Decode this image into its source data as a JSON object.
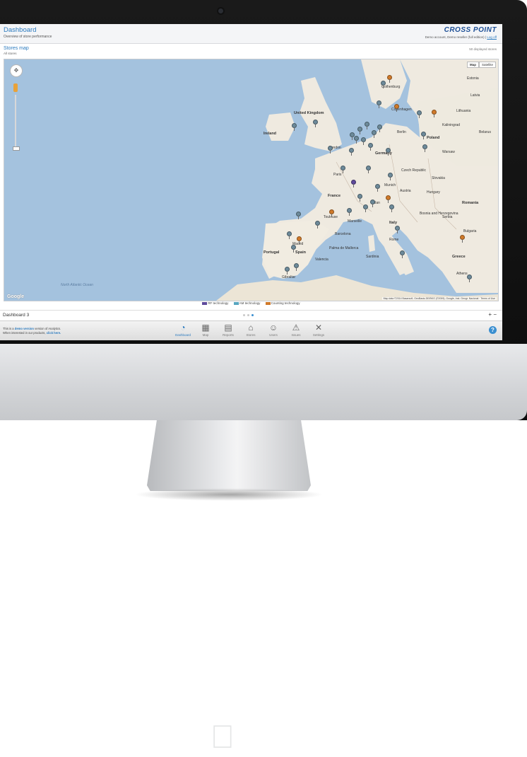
{
  "header": {
    "title": "Dashboard",
    "subtitle": "Overview of store performance",
    "brand": "CROSS POINT",
    "account": "Demo account, Demo reseller (full edition) |",
    "logout": "Log off"
  },
  "section": {
    "title": "Stores map",
    "subtitle": "All stores",
    "count_text": "50 displayed stores"
  },
  "map": {
    "types": [
      "Map",
      "Satellite"
    ],
    "active_type": "Map",
    "logo": "Google",
    "attribution": "Map data ©2014 Basarsoft, GeoBasis-DE/BKG (©2009), Google, Inst. Geogr. Nacional · Terms of Use",
    "labels": {
      "uk": "United Kingdom",
      "ireland": "Ireland",
      "france": "France",
      "spain": "Spain",
      "portugal": "Portugal",
      "germany": "Germany",
      "poland": "Poland",
      "italy": "Italy",
      "romania": "Romania",
      "greece": "Greece",
      "lithuania": "Lithuania",
      "latvia": "Latvia",
      "belarus": "Belarus",
      "czech": "Czech Republic",
      "hungary": "Hungary",
      "slovakia": "Slovakia",
      "austria": "Austria",
      "serbia": "Serbia",
      "bosnia": "Bosnia and Herzegovina",
      "bulgaria": "Bulgaria",
      "estonia": "Estonia",
      "north_atlantic": "North Atlantic Ocean",
      "london": "London",
      "paris": "Paris",
      "madrid": "Madrid",
      "berlin": "Berlin",
      "rome": "Rome",
      "warsaw": "Warsaw",
      "gothenburg": "Gothenburg",
      "copenhagen": "Copenhagen",
      "munich": "Munich",
      "milan": "Milan",
      "barcelona": "Barcelona",
      "marseille": "Marseille",
      "toulouse": "Toulouse",
      "valencia": "Valencia",
      "gibraltar": "Gibraltar",
      "palma": "Palma de Mallorca",
      "sardinia": "Sardinia",
      "athens": "Athens",
      "kaliningrad": "Kaliningrad"
    }
  },
  "legend": {
    "items": [
      {
        "label": "RF technology",
        "color": "#5f4a9c"
      },
      {
        "label": "AM technology",
        "color": "#58a6c0"
      },
      {
        "label": "Counting technology",
        "color": "#d07a2a"
      }
    ]
  },
  "dashboard": {
    "name": "Dashboard 3",
    "add": "+",
    "remove": "−"
  },
  "footer": {
    "note_pre": "This is a",
    "note_link": "demo version",
    "note_post": "version of Analytics.",
    "note_line2": "When interested in our products,",
    "note_link2": "click here."
  },
  "nav": {
    "items": [
      {
        "label": "Dashboard",
        "icon": "speedometer-icon"
      },
      {
        "label": "Map",
        "icon": "map-icon"
      },
      {
        "label": "Reports",
        "icon": "report-icon"
      },
      {
        "label": "Stores",
        "icon": "store-icon"
      },
      {
        "label": "Users",
        "icon": "users-icon"
      },
      {
        "label": "Issues",
        "icon": "warning-icon"
      },
      {
        "label": "Settings",
        "icon": "tools-icon"
      }
    ],
    "active": "Dashboard",
    "help": "?"
  }
}
